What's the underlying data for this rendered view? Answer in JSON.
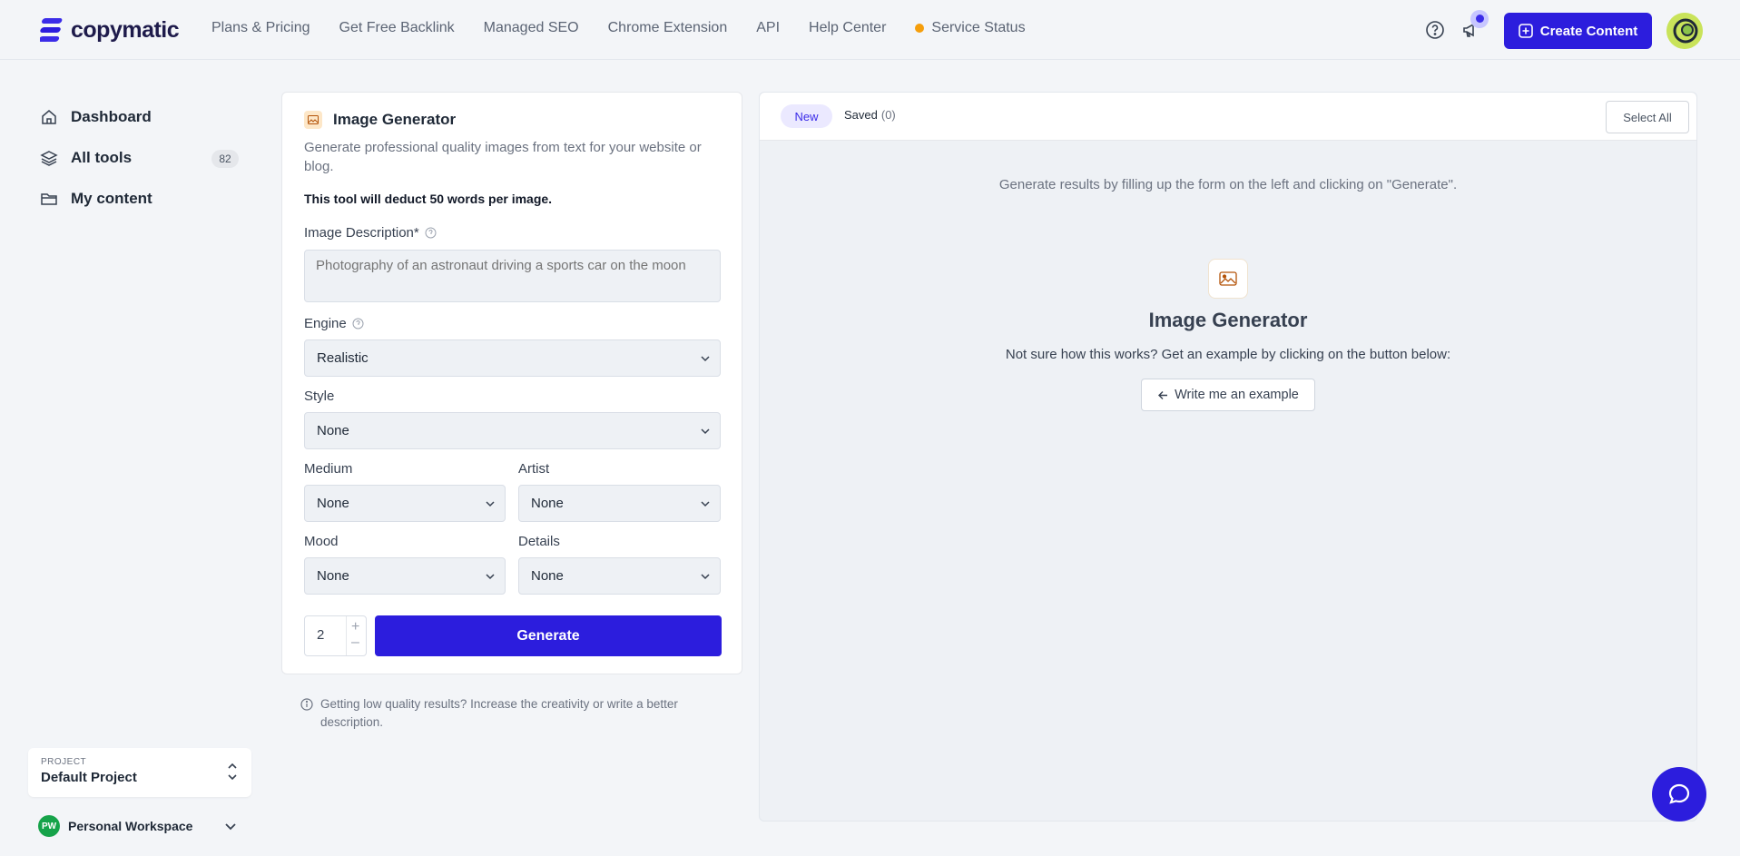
{
  "brand": {
    "name": "copymatic",
    "accent": "#2c1ddd"
  },
  "nav": {
    "items": [
      "Plans & Pricing",
      "Get Free Backlink",
      "Managed SEO",
      "Chrome Extension",
      "API",
      "Help Center"
    ],
    "status_label": "Service Status",
    "status_color": "#f59e0b"
  },
  "header": {
    "create_label": "Create Content"
  },
  "sidebar": {
    "items": [
      {
        "label": "Dashboard",
        "icon": "home-icon"
      },
      {
        "label": "All tools",
        "icon": "layers-icon",
        "badge": "82"
      },
      {
        "label": "My content",
        "icon": "folder-icon"
      }
    ],
    "project": {
      "label": "PROJECT",
      "name": "Default Project"
    },
    "workspace": {
      "initials": "PW",
      "name": "Personal Workspace"
    }
  },
  "form": {
    "title": "Image Generator",
    "description": "Generate professional quality images from text for your website or blog.",
    "note": "This tool will deduct 50 words per image.",
    "image_description": {
      "label": "Image Description*",
      "placeholder": "Photography of an astronaut driving a sports car on the moon"
    },
    "engine": {
      "label": "Engine",
      "value": "Realistic"
    },
    "style": {
      "label": "Style",
      "value": "None"
    },
    "medium": {
      "label": "Medium",
      "value": "None"
    },
    "artist": {
      "label": "Artist",
      "value": "None"
    },
    "mood": {
      "label": "Mood",
      "value": "None"
    },
    "details": {
      "label": "Details",
      "value": "None"
    },
    "quantity": "2",
    "generate_label": "Generate",
    "tip": "Getting low quality results? Increase the creativity or write a better description."
  },
  "results": {
    "tab_new": "New",
    "tab_saved": "Saved",
    "saved_count": "(0)",
    "select_all": "Select All",
    "hint": "Generate results by filling up the form on the left and clicking on \"Generate\".",
    "empty_title": "Image Generator",
    "empty_subtitle": "Not sure how this works? Get an example by clicking on the button below:",
    "example_button": "Write me an example"
  }
}
